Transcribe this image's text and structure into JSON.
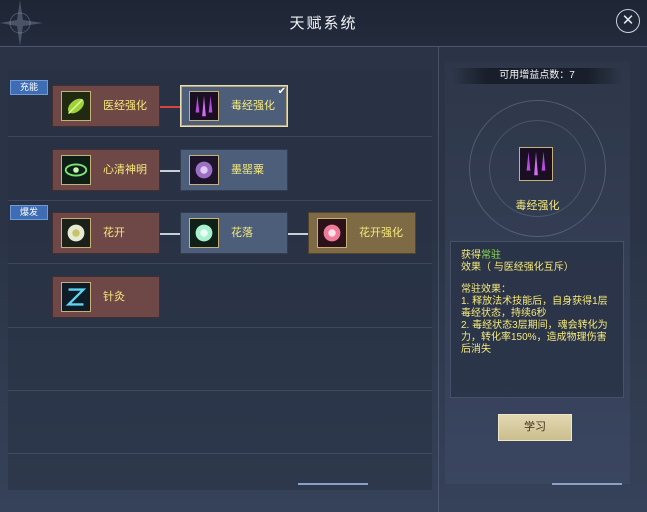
{
  "window": {
    "title": "天赋系统"
  },
  "sections": {
    "charge_tag": "充能",
    "burst_tag": "爆发"
  },
  "nodes": [
    {
      "id": "yijing",
      "label": "医经强化",
      "color": "red",
      "icon": "green-leaf-icon"
    },
    {
      "id": "dujing",
      "label": "毒经强化",
      "color": "blue",
      "icon": "purple-poison-drops-icon",
      "selected": true,
      "check": "✔"
    },
    {
      "id": "xinqing",
      "label": "心清神明",
      "color": "red",
      "icon": "green-eye-icon"
    },
    {
      "id": "moying",
      "label": "墨罂粟",
      "color": "blue",
      "icon": "purple-poppy-icon"
    },
    {
      "id": "huakai",
      "label": "花开",
      "color": "red",
      "icon": "white-lotus-icon"
    },
    {
      "id": "hualuo",
      "label": "花落",
      "color": "blue",
      "icon": "green-lotus-icon"
    },
    {
      "id": "huakaiqh",
      "label": "花开强化",
      "color": "gold",
      "icon": "pink-lotus-icon"
    },
    {
      "id": "zhenjiu",
      "label": "针灸",
      "color": "red",
      "icon": "blue-needle-icon"
    }
  ],
  "detail": {
    "points_label": "可用增益点数：7",
    "name": "毒经强化",
    "desc_prefix": "获得",
    "desc_highlight": "常驻",
    "desc_suffix": "效果（ 与医经强化互斥）",
    "sub_title": "常驻效果：",
    "line1": "1. 释放法术技能后，自身获得1层毒经状态，持续6秒",
    "line2": "2. 毒经状态3层期间，魂会转化为力，转化率150%，造成物理伤害后消失",
    "learn_button": "学习"
  },
  "colors": {
    "node_red": "#6e4747",
    "node_blue": "#4d5e7a",
    "node_gold": "#7e6a44",
    "label_yellow": "#f6ea7a",
    "highlight_green": "#8ddd4e",
    "tag_blue": "#3f6db4",
    "active_link": "#d9443d"
  }
}
